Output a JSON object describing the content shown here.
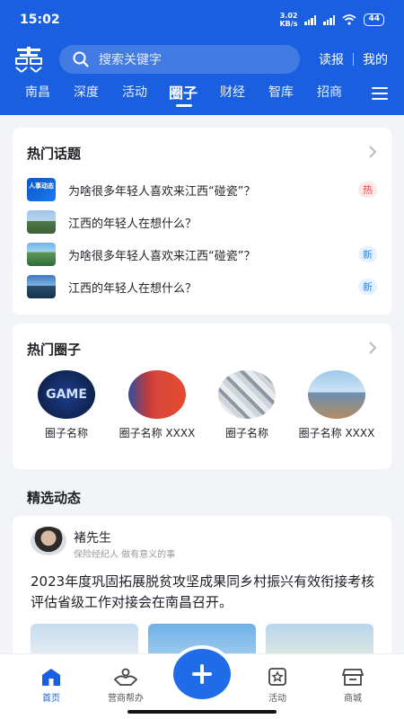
{
  "status": {
    "time": "15:02",
    "speed_value": "3.02",
    "speed_unit": "KB/s",
    "battery": "44"
  },
  "header": {
    "search_placeholder": "搜索关键字",
    "links": [
      "读报",
      "我的"
    ],
    "tabs": [
      {
        "label": "南昌",
        "active": false
      },
      {
        "label": "深度",
        "active": false
      },
      {
        "label": "活动",
        "active": false
      },
      {
        "label": "圈子",
        "active": true
      },
      {
        "label": "财经",
        "active": false
      },
      {
        "label": "智库",
        "active": false
      },
      {
        "label": "招商",
        "active": false
      }
    ]
  },
  "hot_topics": {
    "title": "热门话题",
    "items": [
      {
        "text": "为啥很多年轻人喜欢来江西“碰瓷”？",
        "badge": "热",
        "badge_type": "hot",
        "thumb_text": "人事动态"
      },
      {
        "text": "江西的年轻人在想什么？",
        "badge": "",
        "badge_type": ""
      },
      {
        "text": "为啥很多年轻人喜欢来江西“碰瓷”？",
        "badge": "新",
        "badge_type": "new"
      },
      {
        "text": "江西的年轻人在想什么？",
        "badge": "新",
        "badge_type": "new"
      }
    ]
  },
  "hot_circles": {
    "title": "热门圈子",
    "items": [
      {
        "name": "圈子名称",
        "image_text": "GAME"
      },
      {
        "name": "圈子名称 XXXX"
      },
      {
        "name": "圈子名称"
      },
      {
        "name": "圈子名称 XXXX"
      }
    ]
  },
  "featured": {
    "title": "精选动态",
    "post": {
      "author": "褚先生",
      "author_desc": "保险经纪人 做有意义的事",
      "text": "2023年度巩固拓展脱贫攻坚成果同乡村振兴有效衔接考核评估省级工作对接会在南昌召开。"
    }
  },
  "bottom_nav": [
    {
      "label": "首页",
      "icon": "home-icon",
      "active": true
    },
    {
      "label": "营商帮办",
      "icon": "handshake-icon",
      "active": false
    },
    {
      "label": "活动",
      "icon": "star-doc-icon",
      "active": false
    },
    {
      "label": "商城",
      "icon": "store-icon",
      "active": false
    }
  ],
  "colors": {
    "primary": "#1a5fe0",
    "hot": "#e64646",
    "new": "#2f87e8"
  }
}
